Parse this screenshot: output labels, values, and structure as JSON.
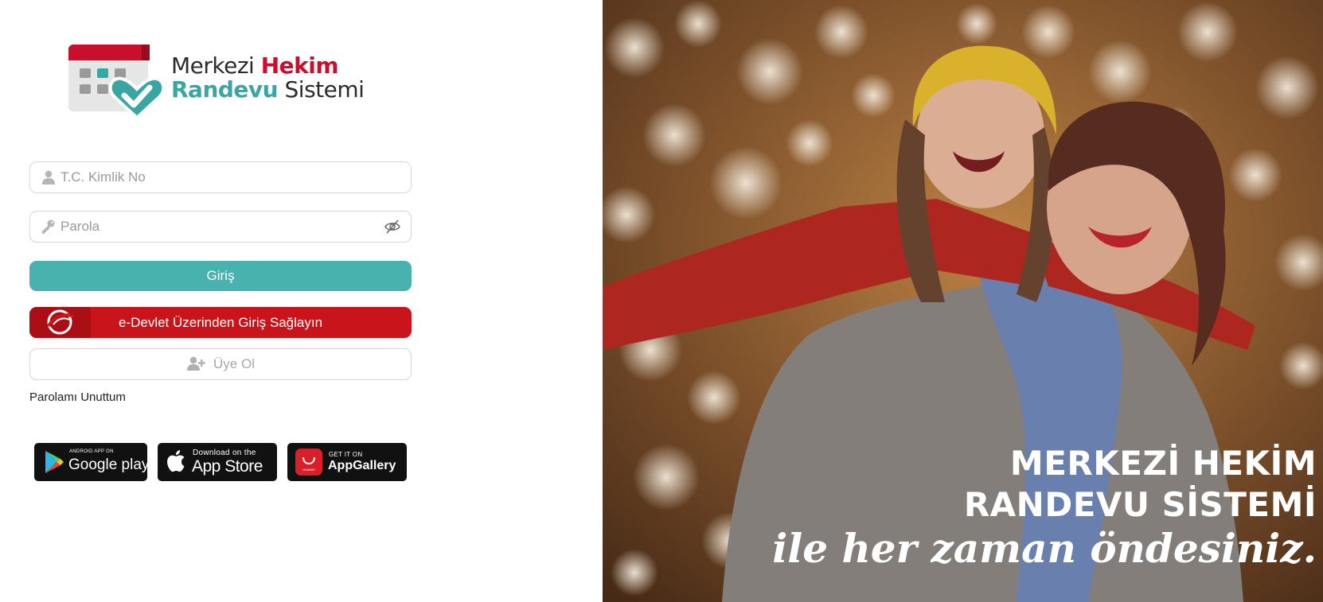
{
  "logo": {
    "line1_word1": "Merkezi",
    "line1_word2": "Hekim",
    "line2_word1": "Randevu",
    "line2_word2": "Sistemi"
  },
  "form": {
    "tc_placeholder": "T.C. Kimlik No",
    "tc_value": "",
    "password_placeholder": "Parola",
    "password_value": "",
    "login_label": "Giriş",
    "edevlet_label": "e-Devlet Üzerinden Giriş Sağlayın",
    "signup_label": "Üye Ol",
    "forgot_label": "Parolamı Unuttum"
  },
  "stores": {
    "google_small": "ANDROID APP ON",
    "google_big": "Google play",
    "apple_small": "Download on the",
    "apple_big": "App Store",
    "huawei_small": "GET IT ON",
    "huawei_big": "AppGallery",
    "huawei_brand": "HUAWEI"
  },
  "banner": {
    "line1": "MERKEZİ HEKİM",
    "line2": "RANDEVU SİSTEMİ",
    "line3": "ile her zaman öndesiniz."
  },
  "colors": {
    "teal": "#47b2ae",
    "red": "#c8141a",
    "brand_red": "#c8102e"
  },
  "icons": [
    "calendar-heart-logo-icon",
    "user-icon",
    "key-icon",
    "eye-slash-icon",
    "add-user-icon",
    "edevlet-logo-icon",
    "google-play-icon",
    "apple-icon",
    "huawei-icon"
  ]
}
